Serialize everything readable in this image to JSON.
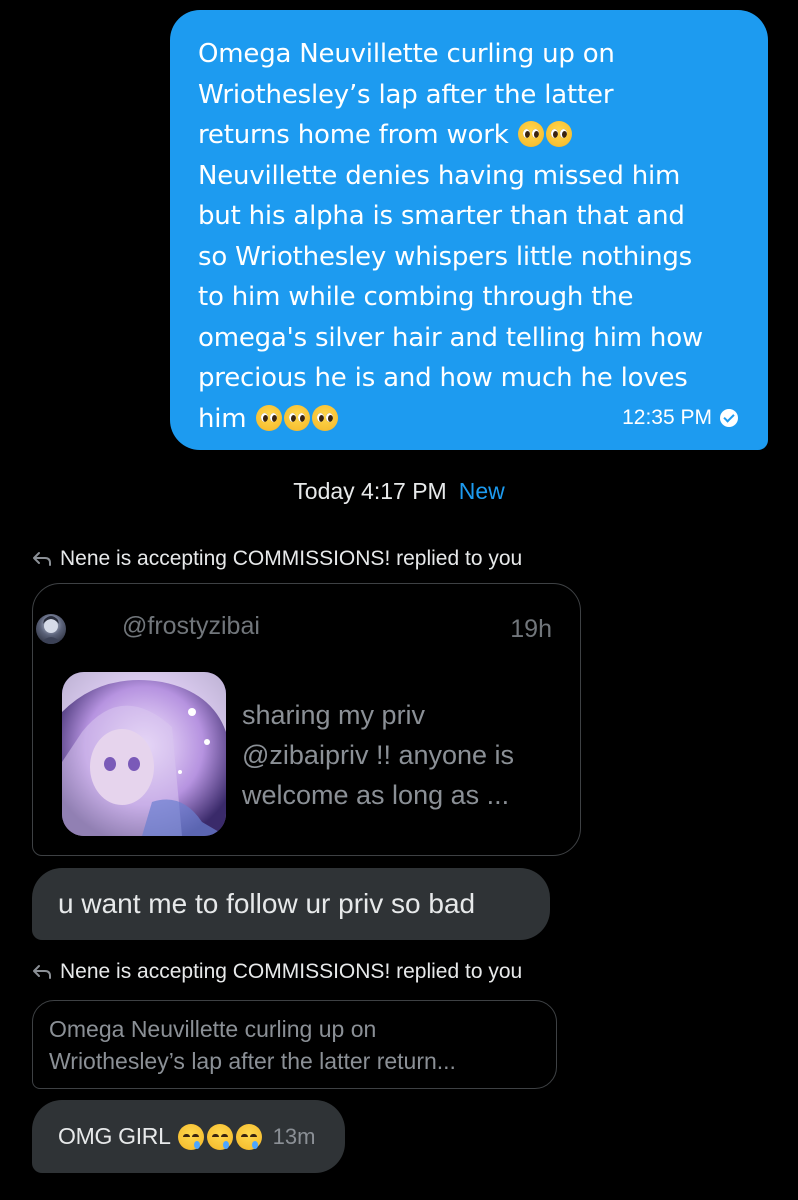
{
  "sent_message": {
    "text_lines": [
      "Omega Neuvillette curling up on",
      "Wriothesley’s lap after the latter",
      "returns home from work",
      "Neuvillette denies having missed him",
      "but his alpha is smarter than that and",
      "so Wriothesley whispers little nothings",
      "to him while combing through the",
      "omega's silver hair and telling him how",
      "precious he is and how much he loves",
      "him"
    ],
    "emoji": "pleading-face",
    "time": "12:35 PM",
    "status_icon": "read-check-icon",
    "bubble_color": "#1d9bf0"
  },
  "divider": {
    "date": "Today 4:17 PM",
    "new_label": "New"
  },
  "reply_1": {
    "header": "Nene is accepting COMMISSIONS! replied to you",
    "quoted_tweet": {
      "handle": "@frostyzibai",
      "age": "19h",
      "text": "sharing my priv\n@zibaipriv !! anyone is\nwelcome as long as ..."
    },
    "message": "u want me to follow ur priv so bad"
  },
  "reply_2": {
    "header": "Nene is accepting COMMISSIONS! replied to you",
    "quoted_text": "Omega Neuvillette curling up on\nWriothesley’s lap after the latter return...",
    "message": "OMG GIRL",
    "emoji": "drooling-face",
    "time": "13m"
  },
  "colors": {
    "background": "#000000",
    "accent": "#1d9bf0",
    "received_bubble": "#2f3336",
    "muted_text": "#71767b"
  }
}
